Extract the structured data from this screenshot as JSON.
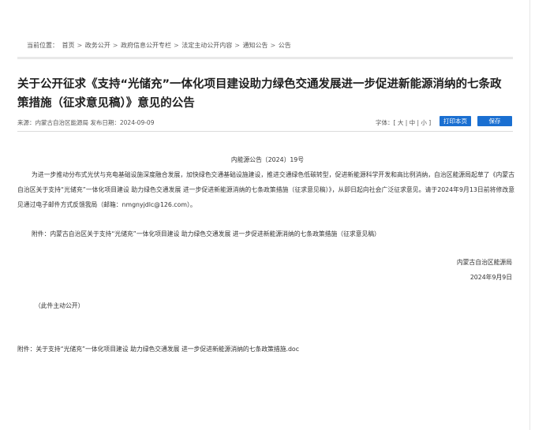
{
  "breadcrumb": {
    "label": "当前位置：",
    "items": [
      "首页",
      "政务公开",
      "政府信息公开专栏",
      "法定主动公开内容",
      "通知公告",
      "公告"
    ],
    "sep": ">"
  },
  "article": {
    "title": "关于公开征求《支持“光储充”一体化项目建设助力绿色交通发展进一步促进新能源消纳的七条政策措施（征求意见稿）》意见的公告",
    "meta": "来源：内蒙古自治区能源局 发布日期：2024-09-09",
    "doc_number": "内能源公告〔2024〕19号",
    "body": "为进一步推动分布式光伏与充电基础设施深度融合发展，加快绿色交通基础设施建设，推进交通绿色低碳转型，促进新能源科学开发和高比例消纳，自治区能源局起草了《内蒙古自治区关于支持“光储充”一体化项目建设 助力绿色交通发展 进一步促进新能源消纳的七条政策措施（征求意见稿）》，从即日起向社会广泛征求意见。请于2024年9月13日前将修改意见通过电子邮件方式反馈我局（邮箱：nmgnyjdlc@126.com）。",
    "attachment_line": "附件：内蒙古自治区关于支持“光储充”一体化项目建设 助力绿色交通发展 进一步促进新能源消纳的七条政策措施（征求意见稿）",
    "sign_org": "内蒙古自治区能源局",
    "sign_date": "2024年9月9日",
    "public_note": "（此件主动公开）",
    "file_link": "附件：关于支持“光储充”一体化项目建设 助力绿色交通发展 进一步促进新能源消纳的七条政策措施.doc"
  },
  "toolbar": {
    "font_label": "字体：",
    "font_sizes": [
      "大",
      "中",
      "小"
    ],
    "print_label": "打印本页",
    "save_label": "保存"
  },
  "colors": {
    "accent": "#1a6fd1"
  }
}
